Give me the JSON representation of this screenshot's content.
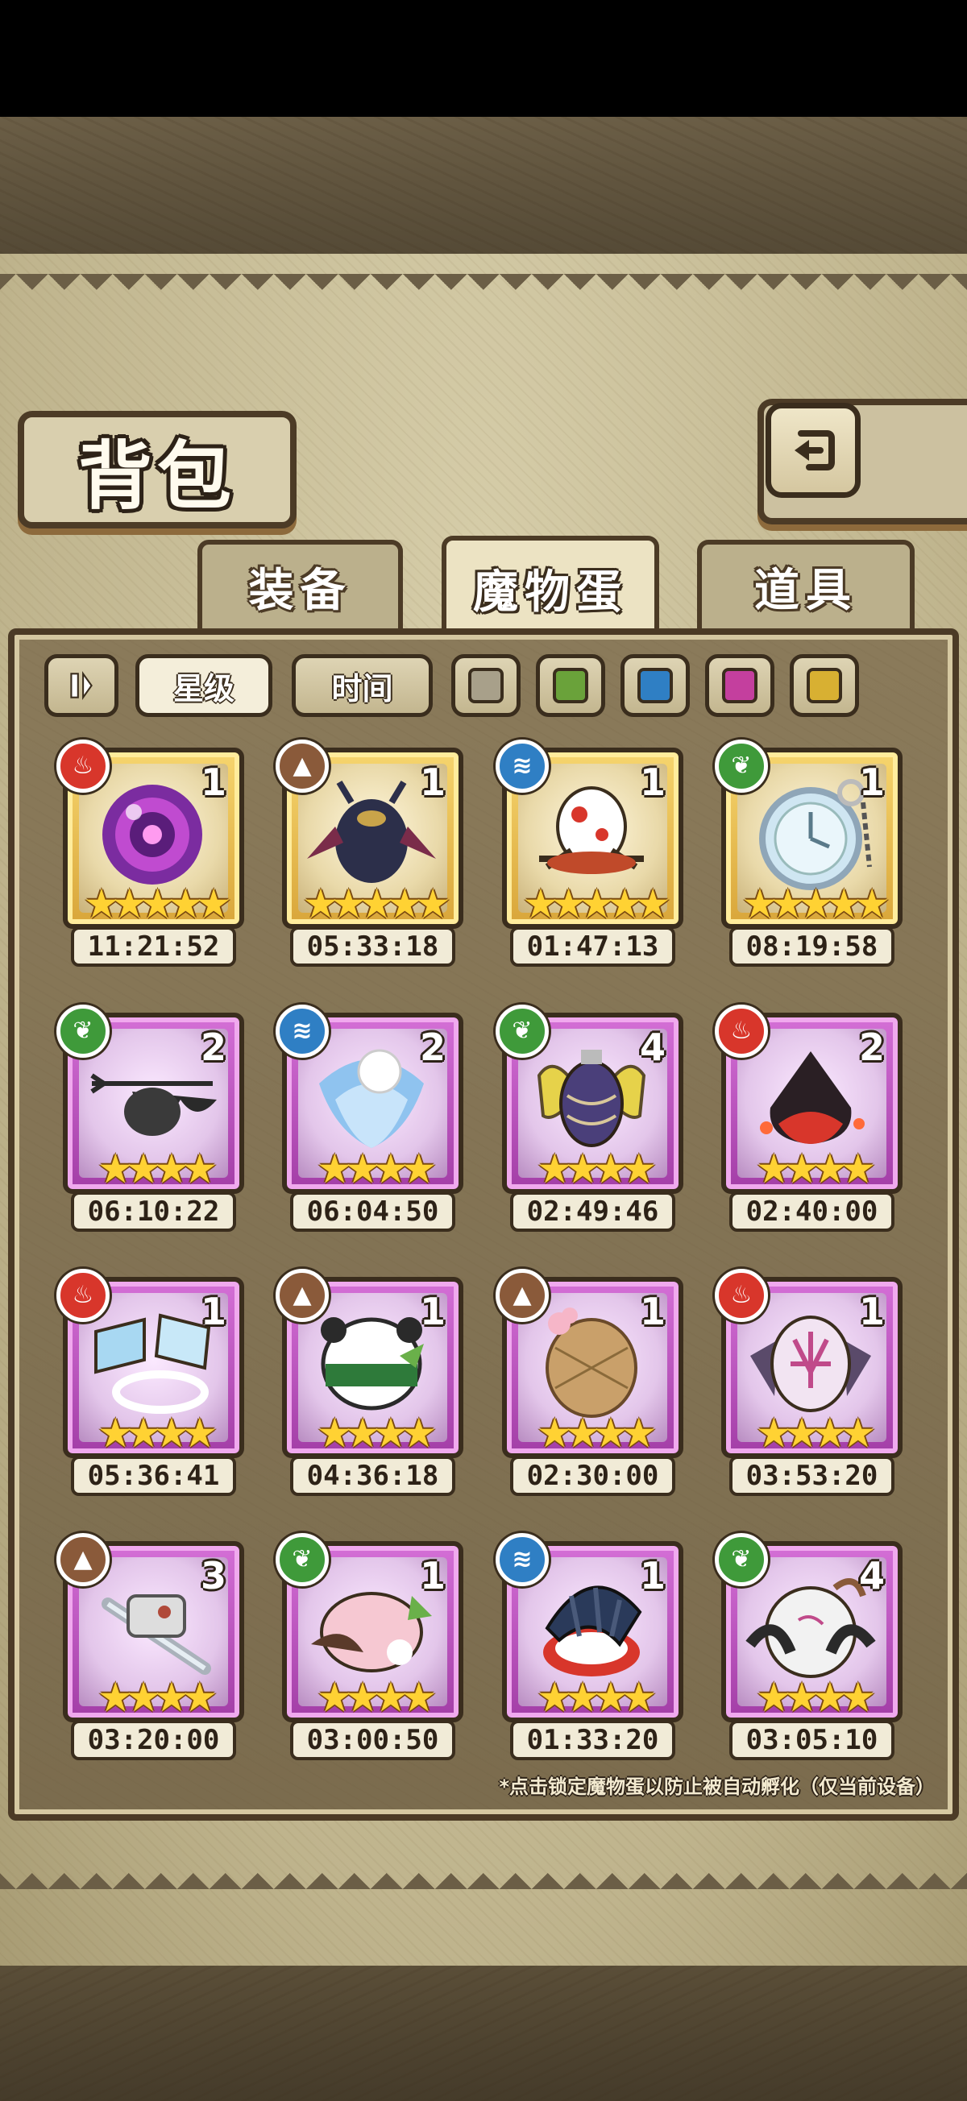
{
  "header": {
    "title": "背包"
  },
  "tabs": [
    {
      "label": "装备",
      "active": false
    },
    {
      "label": "魔物蛋",
      "active": true
    },
    {
      "label": "道具",
      "active": false
    }
  ],
  "filters": {
    "sort_star_label": "星级",
    "sort_time_label": "时间",
    "swatch_colors": [
      "#a8a08a",
      "#6aa23a",
      "#2f7fc4",
      "#c43f9e",
      "#d8b032"
    ]
  },
  "element_colors": {
    "fire": "#d8362b",
    "earth": "#8a5a3a",
    "water": "#2f7fc4",
    "wood": "#3f9a3a"
  },
  "items": [
    {
      "element": "fire",
      "count": "1",
      "stars": 5,
      "rarity": "gold",
      "timer": "11:21:52",
      "art": "orb"
    },
    {
      "element": "earth",
      "count": "1",
      "stars": 5,
      "rarity": "gold",
      "timer": "05:33:18",
      "art": "beetle"
    },
    {
      "element": "water",
      "count": "1",
      "stars": 5,
      "rarity": "gold",
      "timer": "01:47:13",
      "art": "spider"
    },
    {
      "element": "wood",
      "count": "1",
      "stars": 5,
      "rarity": "gold",
      "timer": "08:19:58",
      "art": "watch"
    },
    {
      "element": "wood",
      "count": "2",
      "stars": 4,
      "rarity": "purple",
      "timer": "06:10:22",
      "art": "trident"
    },
    {
      "element": "water",
      "count": "2",
      "stars": 4,
      "rarity": "purple",
      "timer": "06:04:50",
      "art": "flower"
    },
    {
      "element": "wood",
      "count": "4",
      "stars": 4,
      "rarity": "purple",
      "timer": "02:49:46",
      "art": "moth"
    },
    {
      "element": "fire",
      "count": "2",
      "stars": 4,
      "rarity": "purple",
      "timer": "02:40:00",
      "art": "lava"
    },
    {
      "element": "fire",
      "count": "1",
      "stars": 4,
      "rarity": "purple",
      "timer": "05:36:41",
      "art": "flags"
    },
    {
      "element": "earth",
      "count": "1",
      "stars": 4,
      "rarity": "purple",
      "timer": "04:36:18",
      "art": "panda"
    },
    {
      "element": "earth",
      "count": "1",
      "stars": 4,
      "rarity": "purple",
      "timer": "02:30:00",
      "art": "nest"
    },
    {
      "element": "fire",
      "count": "1",
      "stars": 4,
      "rarity": "purple",
      "timer": "03:53:20",
      "art": "batEgg"
    },
    {
      "element": "earth",
      "count": "3",
      "stars": 4,
      "rarity": "purple",
      "timer": "03:20:00",
      "art": "sword"
    },
    {
      "element": "wood",
      "count": "1",
      "stars": 4,
      "rarity": "purple",
      "timer": "03:00:50",
      "art": "piggy"
    },
    {
      "element": "water",
      "count": "1",
      "stars": 4,
      "rarity": "purple",
      "timer": "01:33:20",
      "art": "shell"
    },
    {
      "element": "wood",
      "count": "4",
      "stars": 4,
      "rarity": "purple",
      "timer": "03:05:10",
      "art": "horn"
    }
  ],
  "hint": "*点击锁定魔物蛋以防止被自动孵化（仅当前设备）"
}
